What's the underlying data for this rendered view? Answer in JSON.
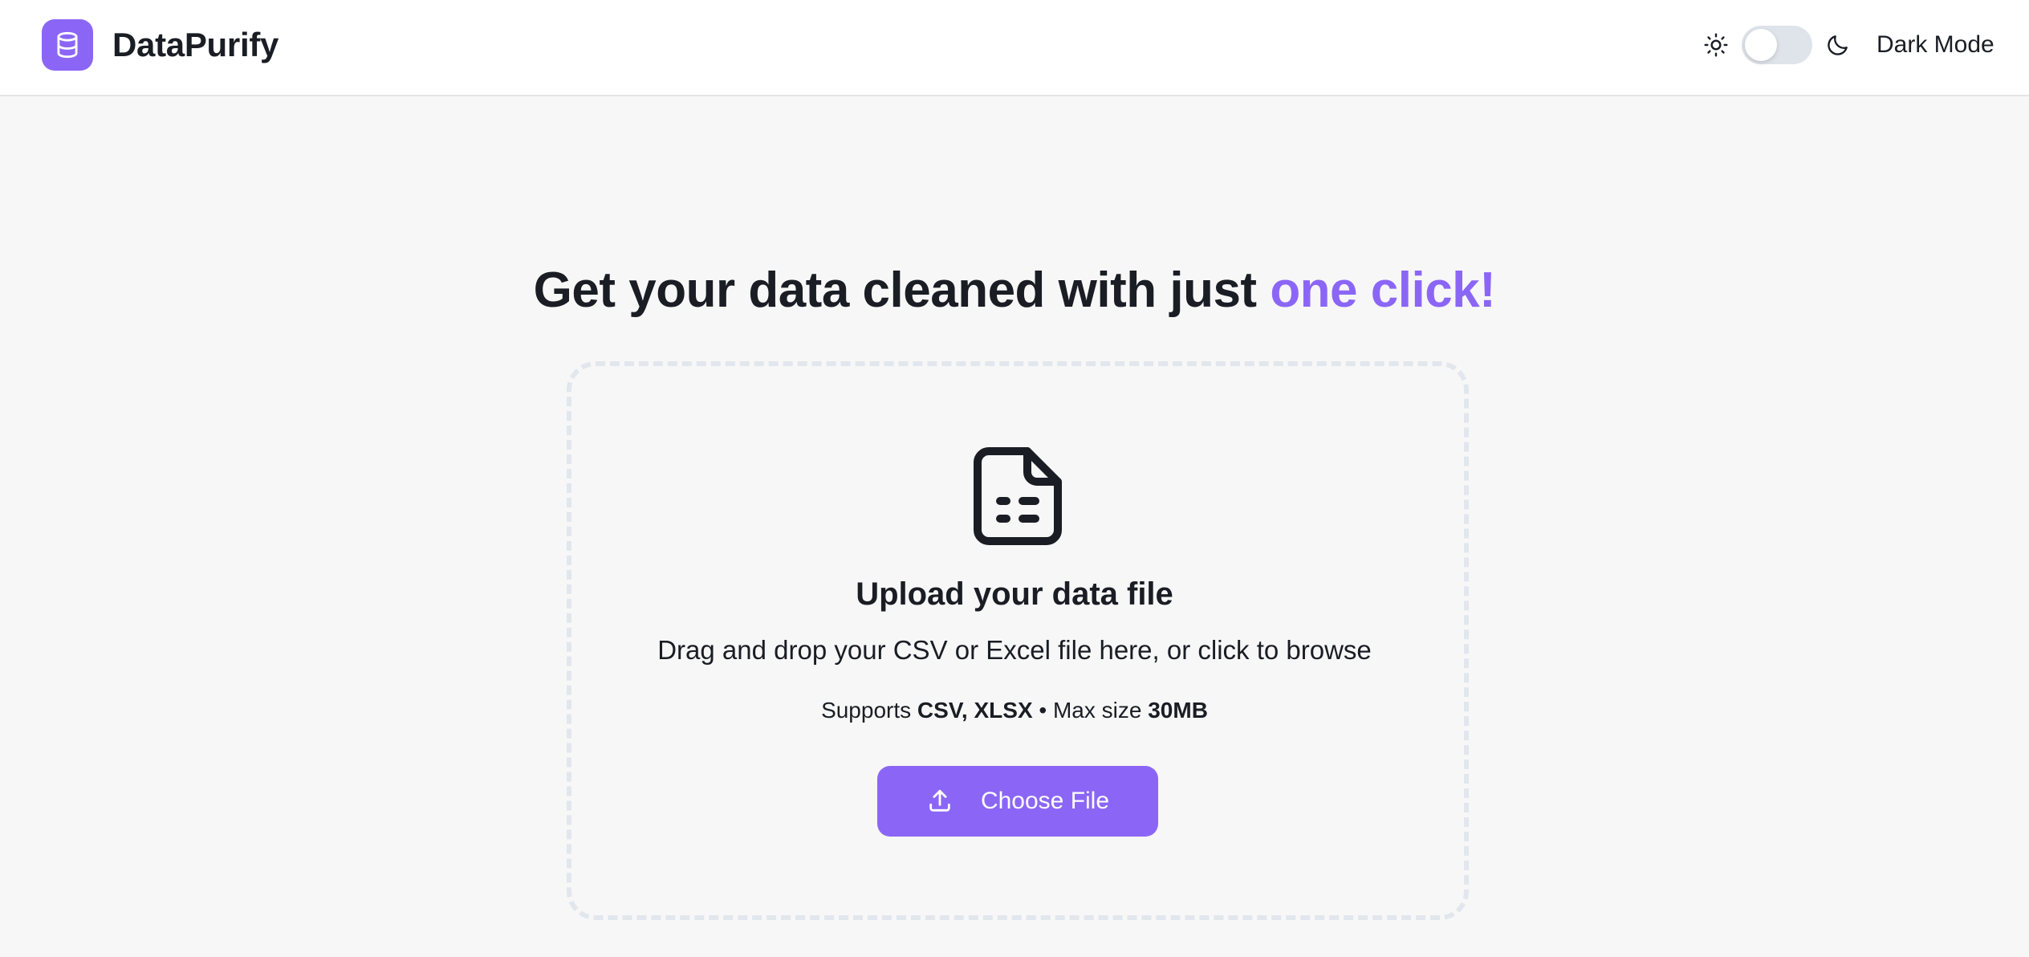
{
  "header": {
    "brand": "DataPurify",
    "logo_icon": "database-icon",
    "theme_toggle": {
      "light_icon": "sun-icon",
      "dark_icon": "moon-icon",
      "state": "light",
      "label": "Dark Mode"
    }
  },
  "hero": {
    "headline_main": "Get your data cleaned with just ",
    "headline_accent": "one click!",
    "accent_color": "#8b66f6"
  },
  "upload": {
    "icon": "file-spreadsheet-icon",
    "title": "Upload your data file",
    "description": "Drag and drop your CSV or Excel file here, or click to browse",
    "supports_prefix": "Supports ",
    "formats": "CSV, XLSX",
    "separator": " • Max size ",
    "max_size": "30MB",
    "button_label": "Choose File",
    "button_icon": "upload-icon"
  }
}
